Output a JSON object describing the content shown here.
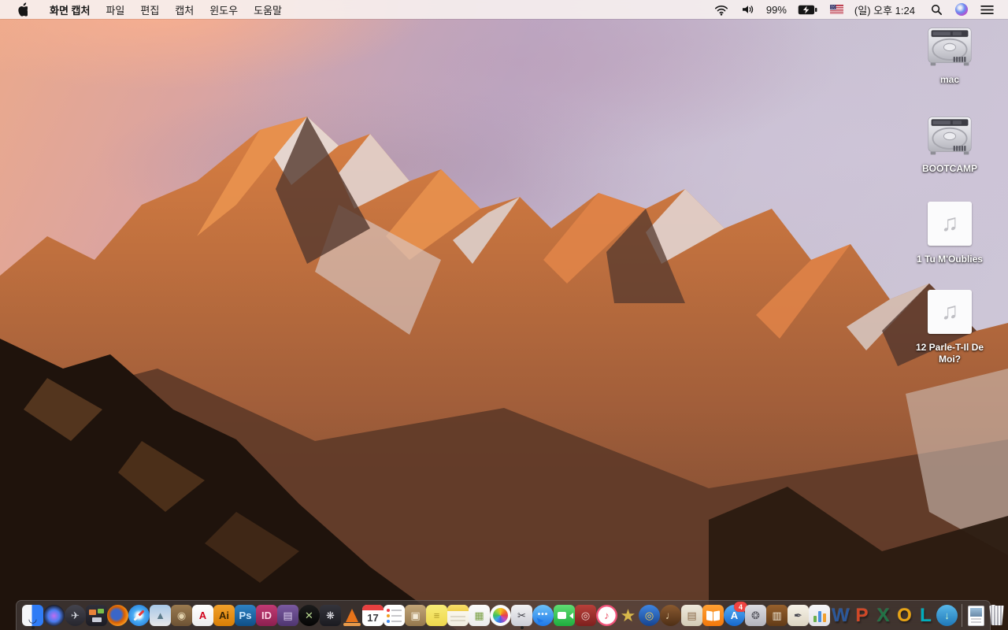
{
  "menubar": {
    "app_name": "화면 캡처",
    "menus": [
      "파일",
      "편집",
      "캡처",
      "윈도우",
      "도움말"
    ],
    "battery_percent": "99%",
    "clock": "(일) 오후 1:24",
    "status_icon_names": [
      "wifi-icon",
      "volume-icon",
      "battery-charging-icon",
      "input-source-us-flag-icon",
      "spotlight-icon",
      "siri-icon",
      "notification-center-icon"
    ]
  },
  "desktop": {
    "icons": [
      {
        "name": "drive-mac",
        "label": "mac",
        "kind": "hard-drive"
      },
      {
        "name": "drive-bootcamp",
        "label": "BOOTCAMP",
        "kind": "hard-drive"
      },
      {
        "name": "audio-file-1",
        "label": "1 Tu M'Oublies",
        "kind": "audio-file"
      },
      {
        "name": "audio-file-12",
        "label": "12 Parle-T-Il De Moi?",
        "kind": "audio-file"
      }
    ]
  },
  "wallpaper": {
    "palette": [
      "#eba98b",
      "#bda8c4",
      "#d97f42",
      "#54382e",
      "#e6dad6",
      "#1f130c"
    ]
  },
  "dock": {
    "items": [
      {
        "name": "finder-icon",
        "kind": "finder",
        "running": true
      },
      {
        "name": "siri-dock-icon",
        "kind": "siri"
      },
      {
        "name": "launchpad-icon",
        "kind": "plain",
        "shape": "circle",
        "c": [
          "#44444e",
          "#26262e"
        ],
        "g": "✈",
        "fg": "#cfd2da"
      },
      {
        "name": "mission-control-icon",
        "kind": "mission"
      },
      {
        "name": "firefox-icon",
        "kind": "firefox"
      },
      {
        "name": "safari-icon",
        "kind": "safari"
      },
      {
        "name": "preview-icon",
        "kind": "plain",
        "shape": "rounded",
        "c": [
          "#a8c8e8",
          "#e8e8ea"
        ],
        "g": "▲",
        "fg": "#5a7a8a"
      },
      {
        "name": "onepassword-icon",
        "kind": "plain",
        "shape": "rounded",
        "c": [
          "#9a7a50",
          "#6d5335"
        ],
        "g": "◉",
        "fg": "#e3d3ae"
      },
      {
        "name": "acrobat-reader-icon",
        "kind": "plain",
        "shape": "rounded",
        "c": [
          "#ffffff",
          "#ededed"
        ],
        "g": "A",
        "fg": "#d0021b"
      },
      {
        "name": "illustrator-icon",
        "kind": "plain",
        "shape": "rounded",
        "c": [
          "#f1a02b",
          "#d97f06"
        ],
        "g": "Ai",
        "fg": "#3a2503"
      },
      {
        "name": "photoshop-icon",
        "kind": "plain",
        "shape": "rounded",
        "c": [
          "#2e82c4",
          "#0f4f87"
        ],
        "g": "Ps",
        "fg": "#cfe9ff"
      },
      {
        "name": "indesign-icon",
        "kind": "plain",
        "shape": "rounded",
        "c": [
          "#c23a74",
          "#8c2050"
        ],
        "g": "ID",
        "fg": "#ffd7e8"
      },
      {
        "name": "unarchiver-icon",
        "kind": "plain",
        "shape": "rounded",
        "c": [
          "#7a5aa0",
          "#4f3670"
        ],
        "g": "▤",
        "fg": "#ded0f0"
      },
      {
        "name": "xee-image-viewer-icon",
        "kind": "plain",
        "shape": "circle",
        "c": [
          "#1c1c1c",
          "#050505"
        ],
        "g": "✕",
        "fg": "#b8d890"
      },
      {
        "name": "fan-control-icon",
        "kind": "plain",
        "shape": "rounded",
        "c": [
          "#34343c",
          "#1b1b21"
        ],
        "g": "❋",
        "fg": "#e6e6ec"
      },
      {
        "name": "vlc-icon",
        "kind": "cone"
      },
      {
        "name": "calendar-icon",
        "kind": "calendar",
        "day": "17"
      },
      {
        "name": "reminders-icon",
        "kind": "reminders"
      },
      {
        "name": "archive-utility-icon",
        "kind": "plain",
        "shape": "rounded",
        "c": [
          "#c2a578",
          "#95784e"
        ],
        "g": "▣",
        "fg": "#f3ead8"
      },
      {
        "name": "stickies-icon",
        "kind": "plain",
        "shape": "rounded",
        "c": [
          "#f8ec77",
          "#eed84e"
        ],
        "g": "≡",
        "fg": "#b09a28"
      },
      {
        "name": "notes-icon",
        "kind": "notes"
      },
      {
        "name": "document-template-app-icon",
        "kind": "plain",
        "shape": "rounded",
        "c": [
          "#fbfbfb",
          "#ececec"
        ],
        "g": "▦",
        "fg": "#7aa045"
      },
      {
        "name": "photos-icon",
        "kind": "photos"
      },
      {
        "name": "grab-screen-capture-icon",
        "kind": "plain",
        "shape": "rounded",
        "c": [
          "#f2f2f4",
          "#cdced6"
        ],
        "g": "✂",
        "fg": "#3a3a42",
        "running": true
      },
      {
        "name": "messages-icon",
        "kind": "bubble"
      },
      {
        "name": "facetime-icon",
        "kind": "facetime"
      },
      {
        "name": "photo-booth-icon",
        "kind": "plain",
        "shape": "rounded",
        "c": [
          "#b8403a",
          "#7e201e"
        ],
        "g": "◎",
        "fg": "#f5d8d2"
      },
      {
        "name": "itunes-icon",
        "kind": "ring"
      },
      {
        "name": "easyfind-icon",
        "kind": "plain",
        "shape": "none",
        "c": [],
        "g": "★",
        "fg": "#d8b84a"
      },
      {
        "name": "dvd-ripper-icon",
        "kind": "plain",
        "shape": "circle",
        "c": [
          "#3f85e0",
          "#16448f"
        ],
        "g": "◎",
        "fg": "#ffd452"
      },
      {
        "name": "garageband-icon",
        "kind": "plain",
        "shape": "circle",
        "c": [
          "#8a5a30",
          "#4e2f16"
        ],
        "g": "♩",
        "fg": "#f0d9ae"
      },
      {
        "name": "iweb-icon",
        "kind": "plain",
        "shape": "rounded",
        "c": [
          "#efe9dc",
          "#d4cbb6"
        ],
        "g": "▤",
        "fg": "#8a6a4a"
      },
      {
        "name": "ibooks-icon",
        "kind": "ibooks"
      },
      {
        "name": "app-store-icon",
        "kind": "plain",
        "shape": "circle",
        "c": [
          "#57aef5",
          "#1669cf"
        ],
        "g": "A",
        "fg": "#ffffff",
        "badge": "4"
      },
      {
        "name": "system-preferences-icon",
        "kind": "plain",
        "shape": "rounded",
        "c": [
          "#dcdce2",
          "#b4b4bd"
        ],
        "g": "❂",
        "fg": "#55555e"
      },
      {
        "name": "keynote-icon",
        "kind": "plain",
        "shape": "rounded",
        "c": [
          "#96602c",
          "#633c18"
        ],
        "g": "▥",
        "fg": "#f2ead8"
      },
      {
        "name": "pages-icon",
        "kind": "plain",
        "shape": "rounded",
        "c": [
          "#f6f2e8",
          "#ddd5c2"
        ],
        "g": "✒",
        "fg": "#44444e"
      },
      {
        "name": "numbers-icon",
        "kind": "numbers"
      },
      {
        "name": "word-icon",
        "kind": "letter",
        "g": "W",
        "fg": "#2b579a"
      },
      {
        "name": "powerpoint-icon",
        "kind": "letter",
        "g": "P",
        "fg": "#d24726"
      },
      {
        "name": "excel-icon",
        "kind": "letter",
        "g": "X",
        "fg": "#217346"
      },
      {
        "name": "outlook-icon",
        "kind": "letter",
        "g": "O",
        "fg": "#e8a312"
      },
      {
        "name": "lync-icon",
        "kind": "letter",
        "g": "L",
        "fg": "#00aebd"
      },
      {
        "name": "download-manager-icon",
        "kind": "plain",
        "shape": "circle",
        "c": [
          "#58b7e8",
          "#1f78b8"
        ],
        "g": "↓",
        "fg": "#c8f5cf"
      },
      {
        "name": "dock-divider",
        "kind": "divider"
      },
      {
        "name": "document-file-icon",
        "kind": "docfile"
      },
      {
        "name": "trash-icon",
        "kind": "trash"
      }
    ]
  }
}
